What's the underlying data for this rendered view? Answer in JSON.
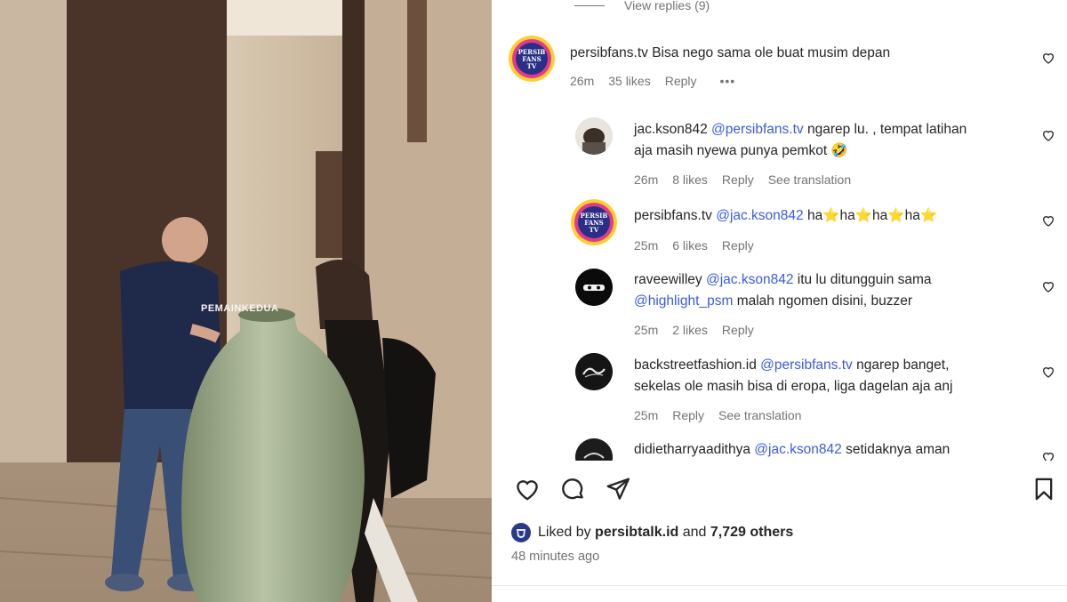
{
  "video": {
    "watermark": "PEMAINKEDUA"
  },
  "thread": {
    "view_replies": "View replies (9)"
  },
  "main_comment": {
    "username": "persibfans.tv",
    "text": "Bisa nego sama ole buat musim depan",
    "avatar_text": [
      "PERSIB",
      "FANS",
      "TV"
    ],
    "time": "26m",
    "likes": "35 likes",
    "reply": "Reply",
    "more": "•••"
  },
  "replies": [
    {
      "username": "jac.kson842",
      "mention": "@persibfans.tv",
      "text_line1": " ngarep lu. , tempat latihan",
      "text_line2": "aja masih nyewa punya pemkot 🤣",
      "time": "26m",
      "likes": "8 likes",
      "reply": "Reply",
      "see_translation": "See translation"
    },
    {
      "username": "persibfans.tv",
      "mention": "@jac.kson842",
      "text_line1": " ha⭐ha⭐ha⭐ha⭐",
      "time": "25m",
      "likes": "6 likes",
      "reply": "Reply"
    },
    {
      "username": "raveewilley",
      "mention": "@jac.kson842",
      "text_line1": " itu lu ditungguin sama",
      "mention2": "@highlight_psm",
      "text_line2": " malah ngomen disini, buzzer",
      "time": "25m",
      "likes": "2 likes",
      "reply": "Reply"
    },
    {
      "username": "backstreetfashion.id",
      "mention": "@persibfans.tv",
      "text_line1": " ngarep banget,",
      "text_line2": "sekelas ole masih bisa di eropa, liga dagelan aja anj",
      "time": "25m",
      "reply": "Reply",
      "see_translation": "See translation"
    },
    {
      "username": "didietharryaadithya",
      "mention": "@jac.kson842",
      "text_line1": " setidaknya aman"
    }
  ],
  "footer": {
    "liked_by_prefix": "Liked by ",
    "liked_by_user": "persibtalk.id",
    "liked_by_and": " and ",
    "liked_by_count": "7,729 others",
    "time_ago": "48 minutes ago"
  },
  "colors": {
    "mention": "#3b5bdb",
    "muted": "#737373",
    "text": "#262626"
  }
}
